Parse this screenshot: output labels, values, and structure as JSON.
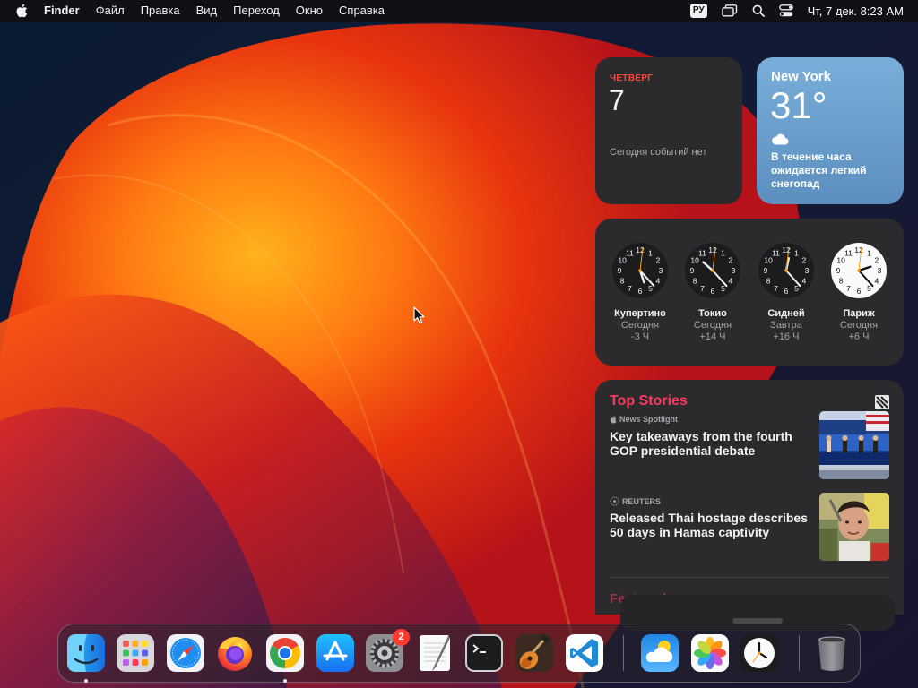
{
  "menubar": {
    "apple_icon": "apple-logo-icon",
    "app_name": "Finder",
    "items": [
      "Файл",
      "Правка",
      "Вид",
      "Переход",
      "Окно",
      "Справка"
    ],
    "input_source": "РУ",
    "status_icons": [
      "screen-mirroring-icon",
      "spotlight-search-icon",
      "control-center-icon"
    ],
    "datetime": "Чт, 7 дек.  8:23 AM"
  },
  "calendar_widget": {
    "day_name": "ЧЕТВЕРГ",
    "day_number": "7",
    "empty_text": "Сегодня событий нет",
    "accent_color": "#ff453a"
  },
  "weather_widget": {
    "city": "New York",
    "temperature": "31°",
    "condition_icon": "cloud-icon",
    "forecast": "В течение часа ожидается легкий снегопад"
  },
  "world_clock_widget": {
    "clocks": [
      {
        "city": "Купертино",
        "day": "Сегодня",
        "offset": "-3 Ч",
        "hour": 5,
        "minute": 23,
        "dark": true
      },
      {
        "city": "Токио",
        "day": "Сегодня",
        "offset": "+14 Ч",
        "hour": 10,
        "minute": 23,
        "dark": true
      },
      {
        "city": "Сидней",
        "day": "Завтра",
        "offset": "+16 Ч",
        "hour": 12,
        "minute": 23,
        "dark": true
      },
      {
        "city": "Париж",
        "day": "Сегодня",
        "offset": "+6 Ч",
        "hour": 2,
        "minute": 23,
        "dark": false
      }
    ]
  },
  "news_widget": {
    "title": "Top Stories",
    "stories": [
      {
        "source": "News Spotlight",
        "headline": "Key takeaways from the fourth GOP presidential debate"
      },
      {
        "source": "REUTERS",
        "headline": "Released Thai hostage describes 50 days in Hamas captivity"
      }
    ],
    "next_section": "Featured",
    "accent_color": "#ff375f"
  },
  "dock": {
    "apps": [
      {
        "name": "Finder",
        "icon": "finder-icon",
        "running": true
      },
      {
        "name": "Launchpad",
        "icon": "launchpad-icon",
        "running": false
      },
      {
        "name": "Safari",
        "icon": "safari-icon",
        "running": false
      },
      {
        "name": "Firefox",
        "icon": "firefox-icon",
        "running": false
      },
      {
        "name": "Google Chrome",
        "icon": "chrome-icon",
        "running": true
      },
      {
        "name": "App Store",
        "icon": "app-store-icon",
        "running": false
      },
      {
        "name": "System Settings",
        "icon": "system-settings-icon",
        "running": false,
        "badge": "2"
      },
      {
        "name": "TextEdit",
        "icon": "textedit-icon",
        "running": false
      },
      {
        "name": "Terminal",
        "icon": "terminal-icon",
        "running": false
      },
      {
        "name": "GarageBand",
        "icon": "garageband-icon",
        "running": false
      },
      {
        "name": "Visual Studio Code",
        "icon": "vscode-icon",
        "running": false
      },
      {
        "name": "Weather",
        "icon": "weather-icon",
        "running": false
      },
      {
        "name": "Photos",
        "icon": "photos-icon",
        "running": false
      },
      {
        "name": "Clock",
        "icon": "clock-icon",
        "running": false
      },
      {
        "name": "Trash",
        "icon": "trash-icon",
        "running": false
      }
    ]
  }
}
